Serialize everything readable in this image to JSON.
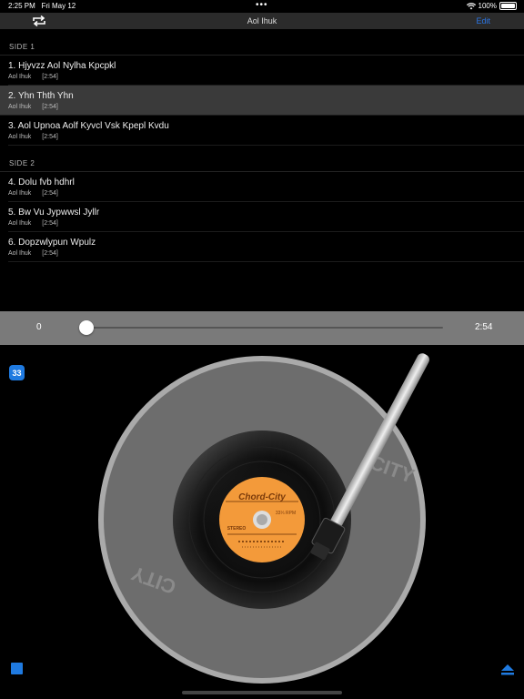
{
  "status": {
    "time": "2:25 PM",
    "date": "Fri May 12",
    "dots": "•••",
    "battery": "100%"
  },
  "nav": {
    "title": "Aol Ihuk",
    "edit": "Edit"
  },
  "sides": [
    {
      "header": "SIDE 1",
      "tracks": [
        {
          "title": "1. Hjyvzz Aol Nylha Kpcpkl",
          "artist": "Aol Ihuk",
          "duration": "[2:54]"
        },
        {
          "title": "2. Yhn Thth Yhn",
          "artist": "Aol Ihuk",
          "duration": "[2:54]",
          "selected": true
        },
        {
          "title": "3. Aol Upnoa Aolf Kyvcl Vsk Kpepl Kvdu",
          "artist": "Aol Ihuk",
          "duration": "[2:54]"
        }
      ]
    },
    {
      "header": "SIDE 2",
      "tracks": [
        {
          "title": "4. Dolu fvb hdhrl",
          "artist": "Aol Ihuk",
          "duration": "[2:54]"
        },
        {
          "title": "5. Bw Vu Jypwwsl Jyllr",
          "artist": "Aol Ihuk",
          "duration": "[2:54]"
        },
        {
          "title": "6. Dopzwlypun Wpulz",
          "artist": "Aol Ihuk",
          "duration": "[2:54]"
        }
      ]
    }
  ],
  "scrubber": {
    "current": "0",
    "total": "2:54",
    "progress": 0.0
  },
  "player": {
    "rpm": "33",
    "platter_text": "CITY",
    "label_brand": "Chord-City",
    "label_rpm": "33⅓ RPM",
    "label_stereo": "STEREO",
    "label_color": "#f39a3a",
    "accent_color": "#1f7ae0"
  }
}
